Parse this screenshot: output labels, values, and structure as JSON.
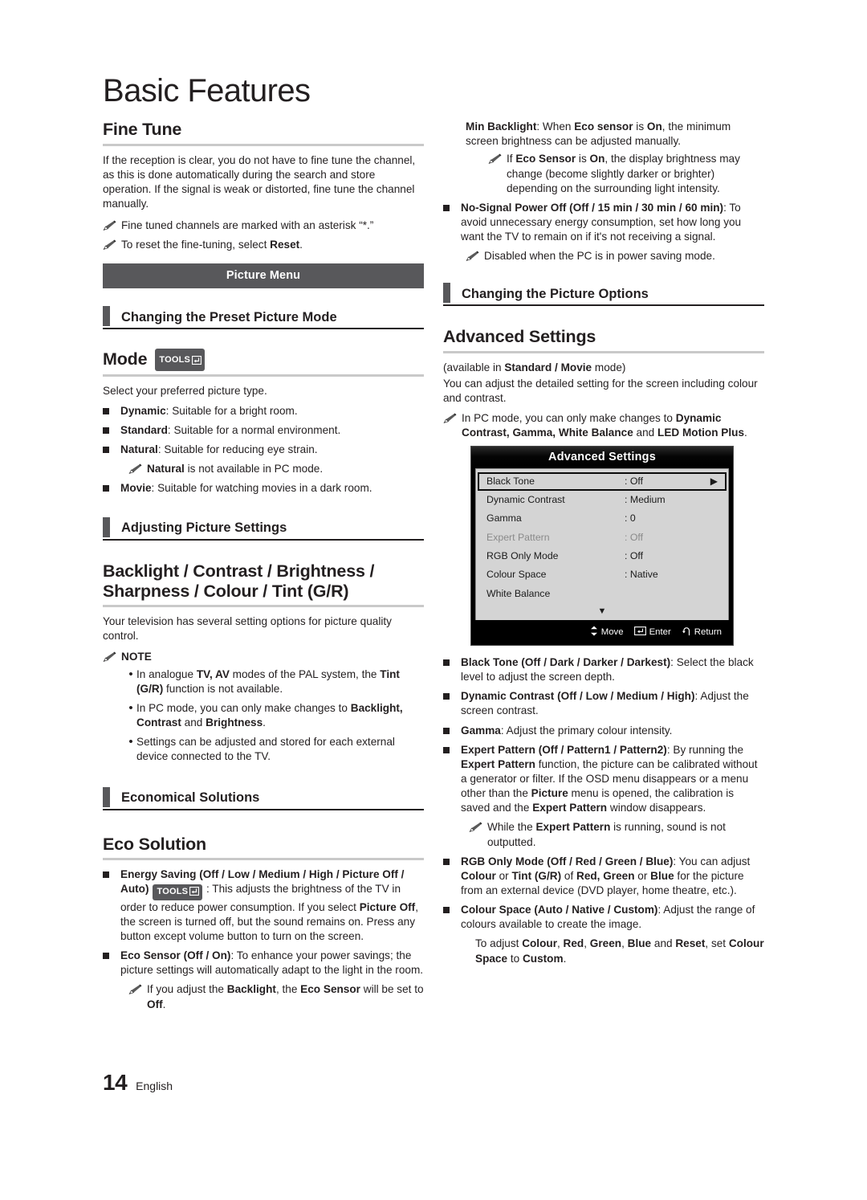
{
  "page": {
    "title": "Basic Features",
    "footer_number": "14",
    "footer_language": "English"
  },
  "left_column": {
    "fine_tune": {
      "heading": "Fine Tune",
      "paragraph": "If the reception is clear, you do not have to fine tune the channel, as this is done automatically during the search and store operation. If the signal is weak or distorted, fine tune the channel manually.",
      "note1": "Fine tuned channels are marked with an asterisk “*.”",
      "note2_pre": "To reset the fine-tuning, select ",
      "note2_bold": "Reset",
      "note2_post": "."
    },
    "picture_menu_band": "Picture Menu",
    "subhead_preset": "Changing the Preset Picture Mode",
    "mode": {
      "heading": "Mode",
      "tools_label": "TOOLS",
      "intro": "Select your preferred picture type.",
      "items": [
        {
          "name": "Dynamic",
          "desc": ": Suitable for a bright room."
        },
        {
          "name": "Standard",
          "desc": ": Suitable for a normal environment."
        },
        {
          "name": "Natural",
          "desc": ": Suitable for reducing eye strain."
        },
        {
          "name": "Movie",
          "desc": ": Suitable for watching movies in a dark room."
        }
      ],
      "natural_note_bold": "Natural",
      "natural_note_rest": " is not available in PC mode."
    },
    "subhead_adjusting": "Adjusting Picture Settings",
    "backlight": {
      "heading": "Backlight / Contrast / Brightness / Sharpness / Colour / Tint (G/R)",
      "paragraph": "Your television has several setting options for picture quality control.",
      "note_label": "NOTE",
      "dots": [
        {
          "pre": "In analogue ",
          "b1": "TV, AV",
          "mid": " modes of the PAL system, the ",
          "b2": "Tint (G/R)",
          "post": " function is not available."
        },
        {
          "pre": "In PC mode, you can only make changes to ",
          "b1": "Backlight, Contrast",
          "mid": " and ",
          "b2": "Brightness",
          "post": "."
        },
        {
          "pre": "Settings can be adjusted and stored for each external device connected to the TV.",
          "b1": "",
          "mid": "",
          "b2": "",
          "post": ""
        }
      ]
    },
    "subhead_economical": "Economical Solutions",
    "eco": {
      "heading": "Eco Solution",
      "energy_saving_bold": "Energy Saving (Off / Low / Medium / High / Picture Off / Auto)",
      "tools_label": "TOOLS",
      "energy_saving_rest_1": " : This adjusts the brightness of the TV in order to reduce power consumption. If you select  ",
      "energy_saving_bold2": "Picture Off",
      "energy_saving_rest_2": ", the screen is turned off, but the sound remains on. Press any button except volume button to turn on the screen.",
      "eco_sensor_bold": "Eco Sensor (Off / On)",
      "eco_sensor_rest": ": To enhance your power savings; the picture settings will automatically adapt to the light in the room.",
      "eco_note_pre": "If you adjust the ",
      "eco_note_b1": "Backlight",
      "eco_note_mid": ", the ",
      "eco_note_b2": "Eco Sensor",
      "eco_note_mid2": " will be set to ",
      "eco_note_b3": "Off",
      "eco_note_post": "."
    }
  },
  "right_column": {
    "min_backlight": {
      "bold": "Min Backlight",
      "rest_pre": ": When ",
      "b1": "Eco sensor",
      "mid": " is ",
      "b2": "On",
      "post": ", the minimum screen brightness can be adjusted manually.",
      "note_pre": "If ",
      "note_b1": "Eco Sensor",
      "note_mid": " is ",
      "note_b2": "On",
      "note_post": ", the display brightness may change (become slightly darker or brighter) depending on the surrounding light intensity."
    },
    "no_signal": {
      "bold": "No-Signal Power Off (Off / 15 min / 30 min / 60 min)",
      "rest": ": To avoid unnecessary energy consumption, set how long you want the TV to remain on if it's not receiving a signal.",
      "note": "Disabled when the PC is in power saving mode."
    },
    "subhead_picture_options": "Changing the Picture Options",
    "advanced": {
      "heading": "Advanced Settings",
      "avail_pre": "(available in ",
      "avail_bold": "Standard / Movie",
      "avail_post": " mode)",
      "paragraph": "You can adjust the detailed setting for the screen including colour and contrast.",
      "note_pre": "In PC mode, you can only make changes to ",
      "note_bold": "Dynamic Contrast, Gamma, White Balance",
      "note_mid": " and ",
      "note_bold2": "LED Motion Plus",
      "note_post": "."
    },
    "osd": {
      "title": "Advanced Settings",
      "rows": [
        {
          "label": "Black Tone",
          "value": ": Off",
          "selected": true,
          "dim": false,
          "arrow": "▶"
        },
        {
          "label": "Dynamic Contrast",
          "value": ": Medium",
          "selected": false,
          "dim": false,
          "arrow": ""
        },
        {
          "label": "Gamma",
          "value": ": 0",
          "selected": false,
          "dim": false,
          "arrow": ""
        },
        {
          "label": "Expert Pattern",
          "value": ": Off",
          "selected": false,
          "dim": true,
          "arrow": ""
        },
        {
          "label": "RGB Only Mode",
          "value": ": Off",
          "selected": false,
          "dim": false,
          "arrow": ""
        },
        {
          "label": "Colour Space",
          "value": ": Native",
          "selected": false,
          "dim": false,
          "arrow": ""
        },
        {
          "label": "White Balance",
          "value": "",
          "selected": false,
          "dim": false,
          "arrow": ""
        }
      ],
      "scroll_arrow": "▼",
      "footer": {
        "move": "Move",
        "enter": "Enter",
        "return": "Return"
      }
    },
    "bullets": {
      "black_tone_bold": "Black Tone (Off / Dark / Darker / Darkest)",
      "black_tone_rest": ": Select the black level to adjust the screen depth.",
      "dyn_contrast_bold": "Dynamic Contrast (Off / Low / Medium / High)",
      "dyn_contrast_rest": ": Adjust the screen contrast.",
      "gamma_bold": "Gamma",
      "gamma_rest": ": Adjust the primary colour intensity.",
      "expert_bold": "Expert Pattern (Off / Pattern1 / Pattern2)",
      "expert_rest_1": ": By running the ",
      "expert_b2": "Expert Pattern",
      "expert_rest_2": " function, the picture can be calibrated without a generator or filter. If the OSD menu disappears or a menu other than the ",
      "expert_b3": "Picture",
      "expert_rest_3": " menu is opened, the calibration is saved and the ",
      "expert_b4": "Expert Pattern",
      "expert_rest_4": " window disappears.",
      "expert_note_pre": "While the ",
      "expert_note_b": "Expert Pattern",
      "expert_note_post": " is running, sound is not outputted.",
      "rgb_bold": "RGB Only Mode (Off / Red / Green / Blue)",
      "rgb_r1": ": You can adjust ",
      "rgb_b1": "Colour",
      "rgb_r2": " or ",
      "rgb_b2": "Tint (G/R)",
      "rgb_r3": " of ",
      "rgb_b3": "Red, Green",
      "rgb_r4": " or ",
      "rgb_b4": "Blue",
      "rgb_r5": " for the picture from an external device (DVD player, home theatre, etc.).",
      "cspace_bold": "Colour Space (Auto / Native / Custom)",
      "cspace_rest": ": Adjust the range of colours available to create the image.",
      "cspace_note_pre": "To adjust ",
      "cspace_b1": "Colour",
      "cspace_m1": ", ",
      "cspace_b2": "Red",
      "cspace_m2": ", ",
      "cspace_b3": "Green",
      "cspace_m3": ", ",
      "cspace_b4": "Blue",
      "cspace_m4": " and ",
      "cspace_b5": "Reset",
      "cspace_m5": ", set ",
      "cspace_b6": "Colour Space",
      "cspace_m6": " to ",
      "cspace_b7": "Custom",
      "cspace_m7": "."
    }
  }
}
